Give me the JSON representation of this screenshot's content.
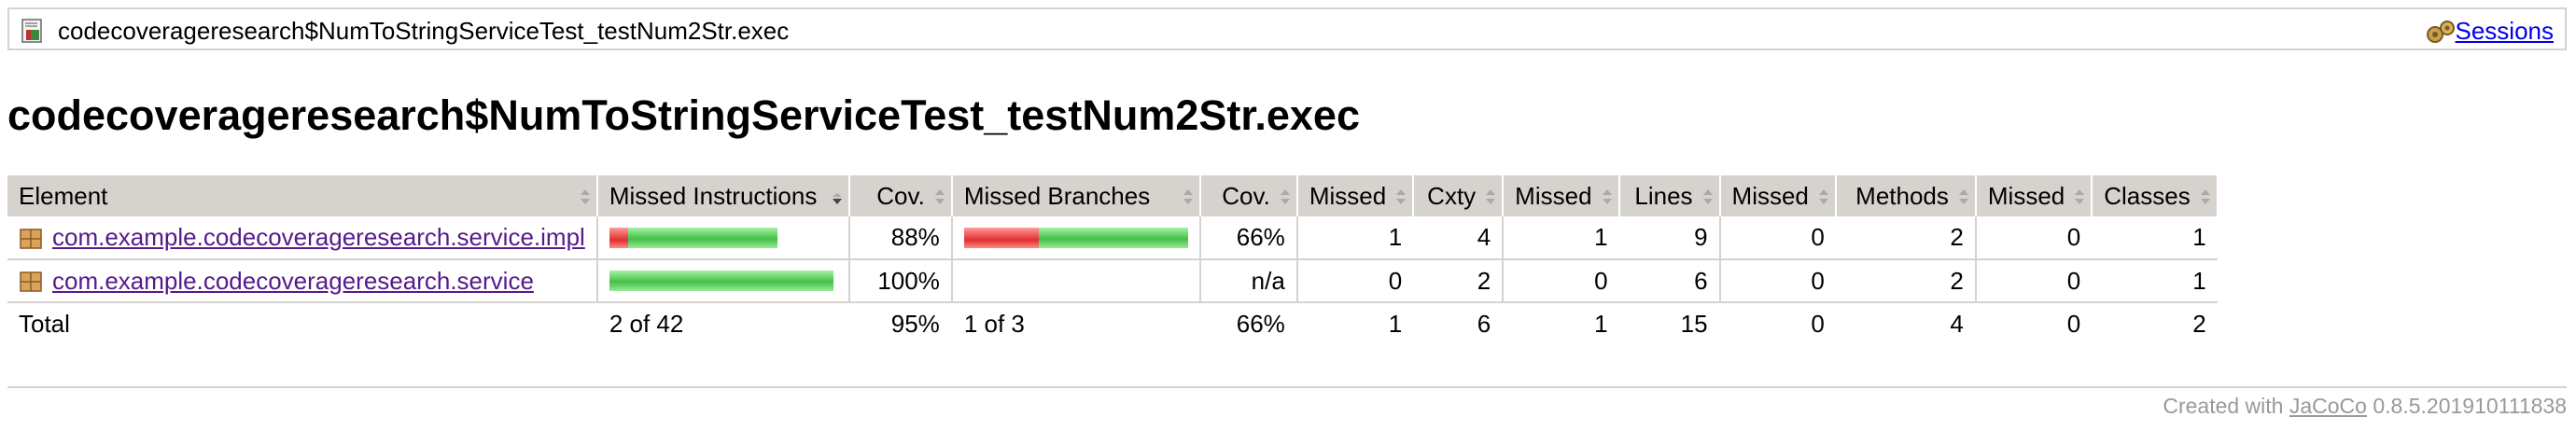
{
  "breadcrumb": {
    "title": "codecoverageresearch$NumToStringServiceTest_testNum2Str.exec",
    "sessions_label": "Sessions"
  },
  "page_title": "codecoverageresearch$NumToStringServiceTest_testNum2Str.exec",
  "table": {
    "headers": [
      "Element",
      "Missed Instructions",
      "Cov.",
      "Missed Branches",
      "Cov.",
      "Missed",
      "Cxty",
      "Missed",
      "Lines",
      "Missed",
      "Methods",
      "Missed",
      "Classes"
    ],
    "rows": [
      {
        "element": "com.example.codecoverageresearch.service.impl",
        "instr_cov": "88%",
        "instr_missed_frac": 0.08,
        "branch_cov": "66%",
        "branch_missed_frac": 0.33,
        "missed_cxty": "1",
        "cxty": "4",
        "missed_lines": "1",
        "lines": "9",
        "missed_methods": "0",
        "methods": "2",
        "missed_classes": "0",
        "classes": "1"
      },
      {
        "element": "com.example.codecoverageresearch.service",
        "instr_cov": "100%",
        "instr_missed_frac": 0.0,
        "branch_cov": "n/a",
        "missed_cxty": "0",
        "cxty": "2",
        "missed_lines": "0",
        "lines": "6",
        "missed_methods": "0",
        "methods": "2",
        "missed_classes": "0",
        "classes": "1"
      }
    ],
    "total": {
      "label": "Total",
      "missed_instructions": "2 of 42",
      "instr_cov": "95%",
      "missed_branches": "1 of 3",
      "branch_cov": "66%",
      "missed_cxty": "1",
      "cxty": "6",
      "missed_lines": "1",
      "lines": "15",
      "missed_methods": "0",
      "methods": "4",
      "missed_classes": "0",
      "classes": "2"
    }
  },
  "footer": {
    "prefix": "Created with",
    "link": "JaCoCo",
    "version": "0.8.5.201910111838"
  },
  "colors": {
    "missed": "#e03030",
    "covered": "#44c044",
    "header_bg": "#d6d3ce"
  },
  "icons": {
    "breadcrumb": "report-icon",
    "sessions": "session-icon",
    "package": "package-icon"
  }
}
